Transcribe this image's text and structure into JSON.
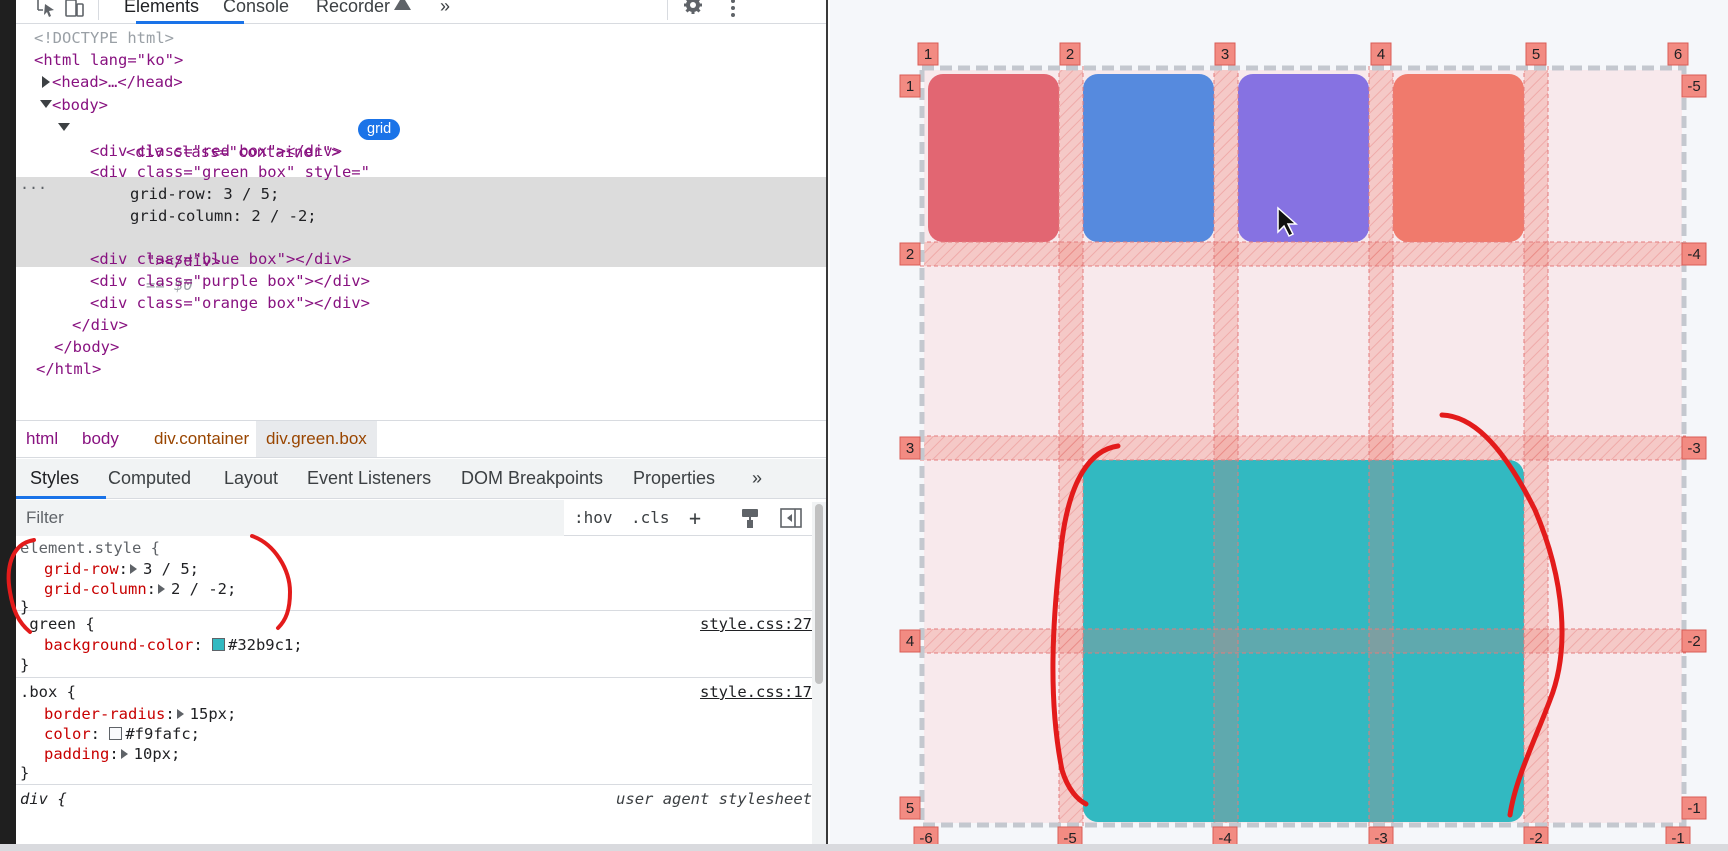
{
  "toolbar": {
    "tabs": [
      "Elements",
      "Console",
      "Recorder",
      "»"
    ],
    "icons": [
      "inspect-element-icon",
      "device-toggle-icon",
      "recorder-flask-icon",
      "gear-icon",
      "kebab-menu-icon"
    ]
  },
  "dom": {
    "doctype": "<!DOCTYPE html>",
    "html_open": "<html lang=\"ko\">",
    "head": "<head>…</head>",
    "body_open": "<body>",
    "container_open": "<div class=\"container\">",
    "grid_badge": "grid",
    "red": "<div class=\"red box\"></div>",
    "green_open": "<div class=\"green box\" style=\"",
    "green_row": "grid-row: 3 / 5;",
    "green_col": "grid-column: 2 / -2;",
    "green_close": "\"></div>",
    "green_eq": "== $0",
    "blue": "<div class=\"blue box\"></div>",
    "purple": "<div class=\"purple box\"></div>",
    "orange": "<div class=\"orange box\"></div>",
    "div_close": "</div>",
    "body_close": "</body>",
    "html_close": "</html>",
    "dots": "···"
  },
  "breadcrumb": [
    "html",
    "body",
    "div.container",
    "div.green.box"
  ],
  "subtabs": [
    "Styles",
    "Computed",
    "Layout",
    "Event Listeners",
    "DOM Breakpoints",
    "Properties",
    "»"
  ],
  "filter": {
    "placeholder": "Filter",
    "hov": ":hov",
    "cls": ".cls",
    "plus": "+"
  },
  "styles": {
    "element_selector": "element.style {",
    "element_props": [
      {
        "name": "grid-row",
        "value": "3 / 5;"
      },
      {
        "name": "grid-column",
        "value": "2 / -2;"
      }
    ],
    "close": "}",
    "green_selector": ".green {",
    "green_source": "style.css:27",
    "green_prop": {
      "name": "background-color",
      "value": "#32b9c1;",
      "swatch": "#32b9c1"
    },
    "box_selector": ".box {",
    "box_source": "style.css:17",
    "box_props": [
      {
        "name": "border-radius",
        "value": "15px;"
      },
      {
        "name": "color",
        "value": "#f9fafc;",
        "swatch": "#f9fafc"
      },
      {
        "name": "padding",
        "value": "10px;"
      }
    ],
    "ua_selector": "div {",
    "ua_source": "user agent stylesheet"
  },
  "grid_overlay": {
    "col_labels_top": [
      "1",
      "2",
      "3",
      "4",
      "5",
      "6"
    ],
    "row_labels_left": [
      "1",
      "2",
      "3",
      "4",
      "5"
    ],
    "row_labels_right": [
      "-5",
      "-4",
      "-3",
      "-2",
      "-1"
    ],
    "col_labels_bottom": [
      "-6",
      "-5",
      "-4",
      "-3",
      "-2",
      "-1"
    ],
    "colors": {
      "red": "#e26672",
      "blue": "#568ade",
      "purple": "#8672e2",
      "orange": "#f07a6c",
      "green": "#32b9c1",
      "label_bg": "#f28b82",
      "annotation": "#e31b1b"
    }
  }
}
